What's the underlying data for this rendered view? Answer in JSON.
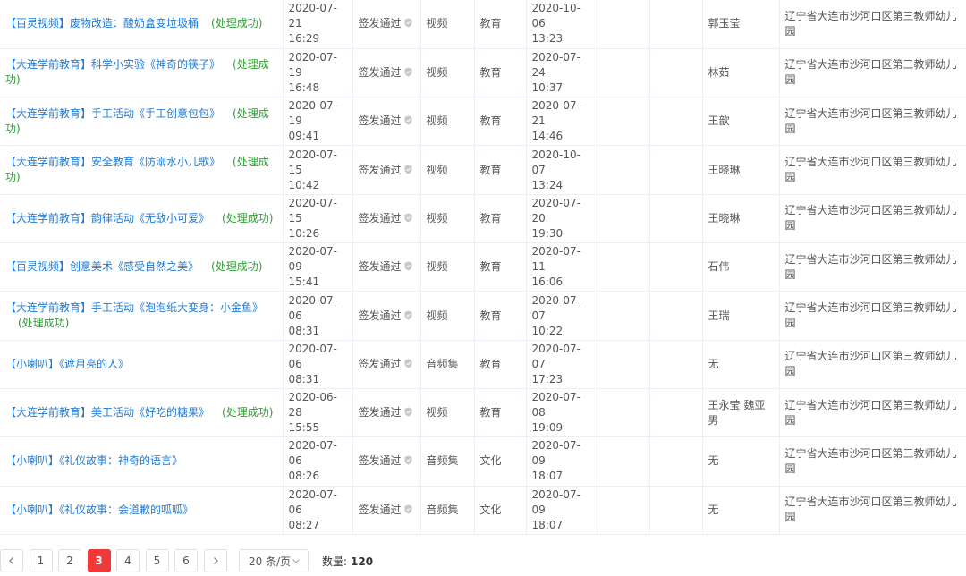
{
  "status_label": "签发通过",
  "rows": [
    {
      "title": "【百灵视频】废物改造：酸奶盒变垃圾桶",
      "result": "(处理成功)",
      "created_date": "2020-07-21",
      "created_time": "16:29",
      "type": "视频",
      "category": "教育",
      "published_date": "2020-10-06",
      "published_time": "13:23",
      "author": "郭玉莹",
      "org": "辽宁省大连市沙河口区第三教师幼儿园"
    },
    {
      "title": "【大连学前教育】科学小实验《神奇的筷子》",
      "result": "(处理成功)",
      "created_date": "2020-07-19",
      "created_time": "16:48",
      "type": "视频",
      "category": "教育",
      "published_date": "2020-07-24",
      "published_time": "10:37",
      "author": "林茹",
      "org": "辽宁省大连市沙河口区第三教师幼儿园"
    },
    {
      "title": "【大连学前教育】手工活动《手工创意包包》",
      "result": "(处理成功)",
      "created_date": "2020-07-19",
      "created_time": "09:41",
      "type": "视频",
      "category": "教育",
      "published_date": "2020-07-21",
      "published_time": "14:46",
      "author": "王歆",
      "org": "辽宁省大连市沙河口区第三教师幼儿园"
    },
    {
      "title": "【大连学前教育】安全教育《防溺水小儿歌》",
      "result": "(处理成功)",
      "created_date": "2020-07-15",
      "created_time": "10:42",
      "type": "视频",
      "category": "教育",
      "published_date": "2020-10-07",
      "published_time": "13:24",
      "author": "王晓琳",
      "org": "辽宁省大连市沙河口区第三教师幼儿园"
    },
    {
      "title": "【大连学前教育】韵律活动《无敌小可爱》",
      "result": "(处理成功)",
      "created_date": "2020-07-15",
      "created_time": "10:26",
      "type": "视频",
      "category": "教育",
      "published_date": "2020-07-20",
      "published_time": "19:30",
      "author": "王晓琳",
      "org": "辽宁省大连市沙河口区第三教师幼儿园"
    },
    {
      "title": "【百灵视频】创意美术《感受自然之美》",
      "result": "(处理成功)",
      "created_date": "2020-07-09",
      "created_time": "15:41",
      "type": "视频",
      "category": "教育",
      "published_date": "2020-07-11",
      "published_time": "16:06",
      "author": "石伟",
      "org": "辽宁省大连市沙河口区第三教师幼儿园"
    },
    {
      "title": "【大连学前教育】手工活动《泡泡纸大变身：小金鱼》",
      "result": "(处理成功)",
      "created_date": "2020-07-06",
      "created_time": "08:31",
      "type": "视频",
      "category": "教育",
      "published_date": "2020-07-07",
      "published_time": "10:22",
      "author": "王瑞",
      "org": "辽宁省大连市沙河口区第三教师幼儿园"
    },
    {
      "title": "【小喇叭】《遮月亮的人》",
      "result": "",
      "created_date": "2020-07-06",
      "created_time": "08:31",
      "type": "音频集",
      "category": "教育",
      "published_date": "2020-07-07",
      "published_time": "17:23",
      "author": "无",
      "org": "辽宁省大连市沙河口区第三教师幼儿园"
    },
    {
      "title": "【大连学前教育】美工活动《好吃的糖果》",
      "result": "(处理成功)",
      "created_date": "2020-06-28",
      "created_time": "15:55",
      "type": "视频",
      "category": "教育",
      "published_date": "2020-07-08",
      "published_time": "19:09",
      "author": "王永莹 魏亚男",
      "org": "辽宁省大连市沙河口区第三教师幼儿园"
    },
    {
      "title": "【小喇叭】《礼仪故事：神奇的语言》",
      "result": "",
      "created_date": "2020-07-06",
      "created_time": "08:26",
      "type": "音频集",
      "category": "文化",
      "published_date": "2020-07-09",
      "published_time": "18:07",
      "author": "无",
      "org": "辽宁省大连市沙河口区第三教师幼儿园"
    },
    {
      "title": "【小喇叭】《礼仪故事：会道歉的呱呱》",
      "result": "",
      "created_date": "2020-07-06",
      "created_time": "08:27",
      "type": "音频集",
      "category": "文化",
      "published_date": "2020-07-09",
      "published_time": "18:07",
      "author": "无",
      "org": "辽宁省大连市沙河口区第三教师幼儿园"
    }
  ],
  "pagination": {
    "prev_icon": "chevron-left-icon",
    "next_icon": "chevron-right-icon",
    "pages": [
      "1",
      "2",
      "3",
      "4",
      "5",
      "6"
    ],
    "current": "3",
    "page_size": "20 条/页",
    "total_label": "数量:",
    "total": "120"
  },
  "colors": {
    "link": "#1f7bd6",
    "success": "#2e9e33",
    "active_page": "#f03a3a",
    "border": "#ebeef5"
  }
}
